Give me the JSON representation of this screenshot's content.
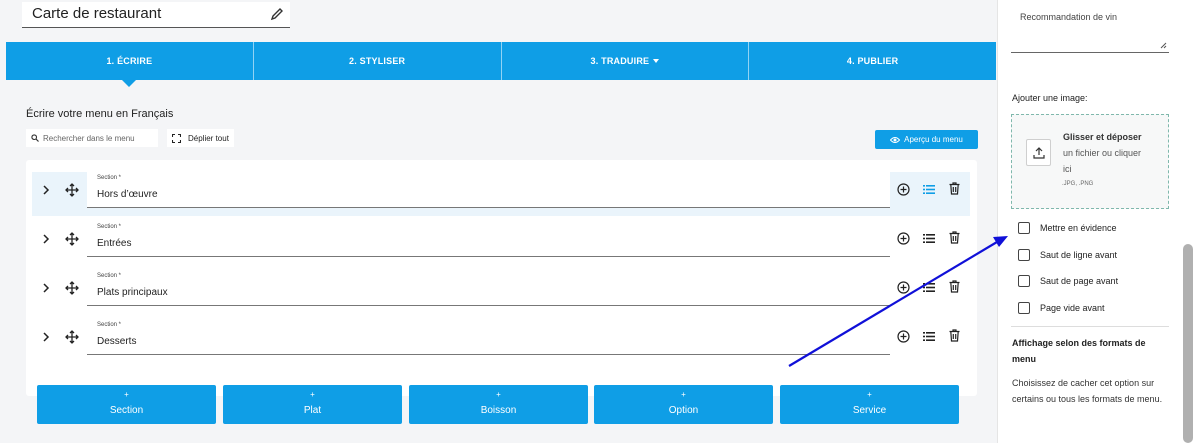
{
  "menu": {
    "title": "Carte de restaurant"
  },
  "steps": [
    {
      "label": "1. ÉCRIRE",
      "active": true
    },
    {
      "label": "2. STYLISER",
      "active": false
    },
    {
      "label": "3. TRADUIRE",
      "active": false,
      "has_dropdown": true
    },
    {
      "label": "4. PUBLIER",
      "active": false
    }
  ],
  "editor": {
    "heading": "Écrire votre menu en Français",
    "search_placeholder": "Rechercher dans le menu",
    "expand_label": "Déplier tout",
    "preview_label": "Aperçu du menu"
  },
  "sections": [
    {
      "label": "Section *",
      "value": "Hors d’œuvre",
      "highlighted": true
    },
    {
      "label": "Section *",
      "value": "Entrées",
      "highlighted": false
    },
    {
      "label": "Section *",
      "value": "Plats principaux",
      "highlighted": false
    },
    {
      "label": "Section *",
      "value": "Desserts",
      "highlighted": false
    }
  ],
  "add_buttons": [
    {
      "plus": "+",
      "label": "Section"
    },
    {
      "plus": "+",
      "label": "Plat"
    },
    {
      "plus": "+",
      "label": "Boisson"
    },
    {
      "plus": "+",
      "label": "Option"
    },
    {
      "plus": "+",
      "label": "Service"
    }
  ],
  "right_panel": {
    "wine_label": "Recommandation de vin",
    "image_label": "Ajouter une image:",
    "dropzone": {
      "title": "Glisser et déposer",
      "line2": "un fichier ou cliquer",
      "line3": "ici",
      "formats": ".JPG, .PNG"
    },
    "checkboxes": [
      {
        "label": "Mettre en évidence",
        "checked": false
      },
      {
        "label": "Saut de ligne avant",
        "checked": false
      },
      {
        "label": "Saut de page avant",
        "checked": false
      },
      {
        "label": "Page vide avant",
        "checked": false
      }
    ],
    "format_heading": "Affichage selon des formats de menu",
    "format_desc": "Choisissez de cacher cet option sur certains ou tous les formats de menu."
  },
  "colors": {
    "accent": "#0f9ee6",
    "annotation_arrow": "#1010d8"
  }
}
